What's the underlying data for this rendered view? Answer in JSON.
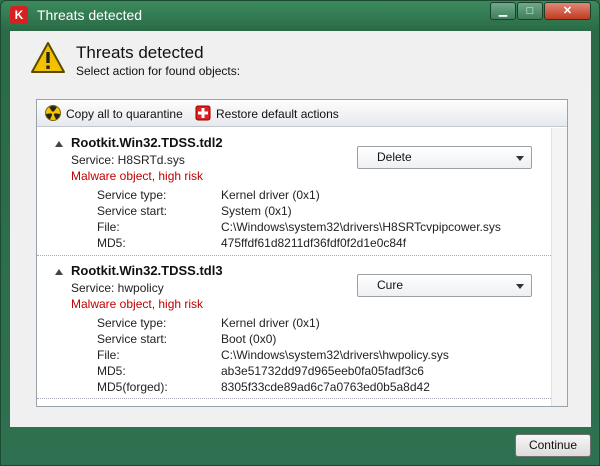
{
  "window": {
    "title": "Threats detected",
    "logo_glyph": "K"
  },
  "window_buttons": {
    "minimize": "▁",
    "maximize": "□",
    "close": "✕"
  },
  "header": {
    "title": "Threats detected",
    "subtitle": "Select action for found objects:",
    "icon": "warning-icon"
  },
  "toolbar": {
    "copy_label": "Copy all to quarantine",
    "restore_label": "Restore default actions"
  },
  "threats": [
    {
      "name": "Rootkit.Win32.TDSS.tdl2",
      "service": "Service: H8SRTd.sys",
      "risk": "Malware object, high risk",
      "action": "Delete",
      "details": [
        {
          "label": "Service type:",
          "value": "Kernel driver (0x1)"
        },
        {
          "label": "Service start:",
          "value": "System (0x1)"
        },
        {
          "label": "File:",
          "value": "C:\\Windows\\system32\\drivers\\H8SRTcvpipcower.sys"
        },
        {
          "label": "MD5:",
          "value": "475ffdf61d8211df36fdf0f2d1e0c84f"
        }
      ]
    },
    {
      "name": "Rootkit.Win32.TDSS.tdl3",
      "service": "Service: hwpolicy",
      "risk": "Malware object, high risk",
      "action": "Cure",
      "details": [
        {
          "label": "Service type:",
          "value": "Kernel driver (0x1)"
        },
        {
          "label": "Service start:",
          "value": "Boot (0x0)"
        },
        {
          "label": "File:",
          "value": "C:\\Windows\\system32\\drivers\\hwpolicy.sys"
        },
        {
          "label": "MD5:",
          "value": "ab3e51732dd97d965eeb0fa05fadf3c6"
        },
        {
          "label": "MD5(forged):",
          "value": "8305f33cde89ad6c7a0763ed0b5a8d42"
        }
      ]
    }
  ],
  "footer": {
    "continue_label": "Continue"
  },
  "colors": {
    "title_bar": "#2f7050",
    "risk_text": "#c00000",
    "warning_icon": "#f2c200"
  }
}
